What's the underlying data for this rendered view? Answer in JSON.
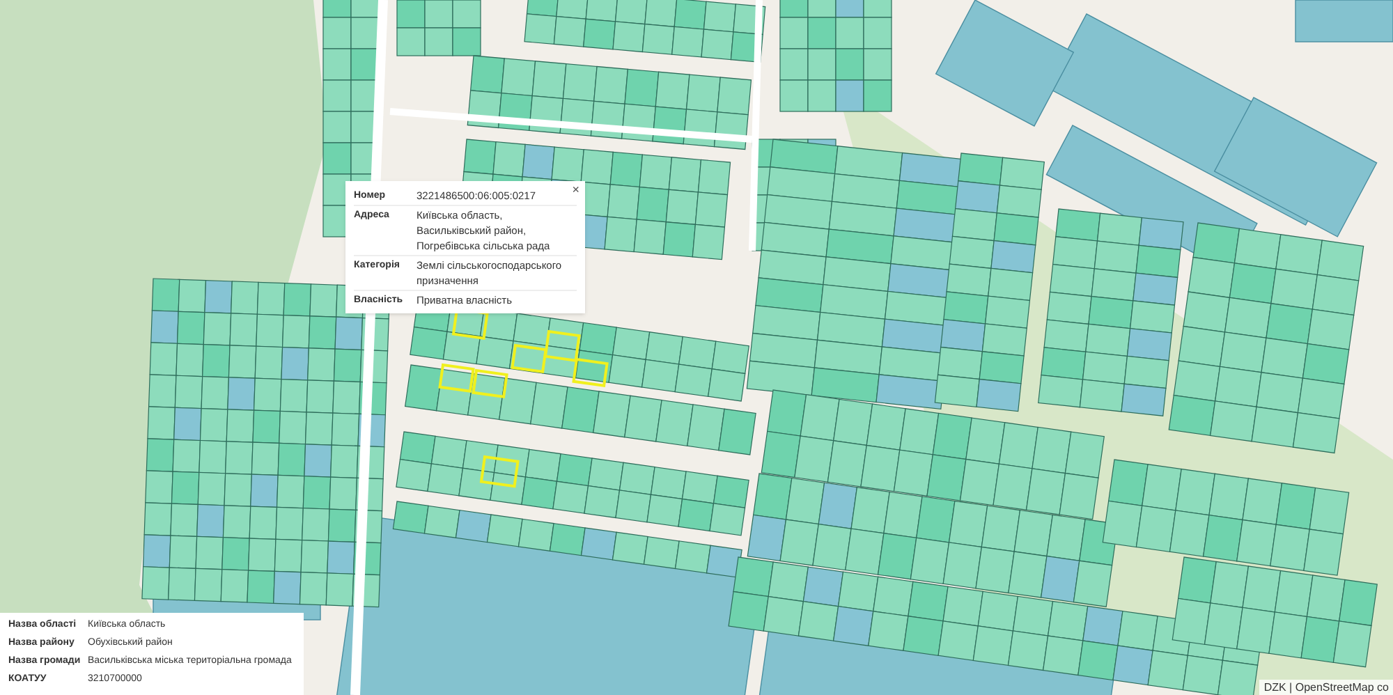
{
  "popup": {
    "close": "×",
    "rows": [
      {
        "label": "Номер",
        "value": "3221486500:06:005:0217"
      },
      {
        "label": "Адреса",
        "value": "Київська область, Васильківський район, Погребівська сільська рада"
      },
      {
        "label": "Категорія",
        "value": "Землі сільськогосподарського призначення"
      },
      {
        "label": "Власність",
        "value": "Приватна власність"
      }
    ]
  },
  "info_panel": {
    "rows": [
      {
        "label": "Назва області",
        "value": "Київська область"
      },
      {
        "label": "Назва району",
        "value": "Обухівський район"
      },
      {
        "label": "Назва громади",
        "value": "Васильківська міська територіальна громада"
      },
      {
        "label": "КОАТУУ",
        "value": "3210700000"
      }
    ]
  },
  "attribution": "DZK | OpenStreetMap co"
}
